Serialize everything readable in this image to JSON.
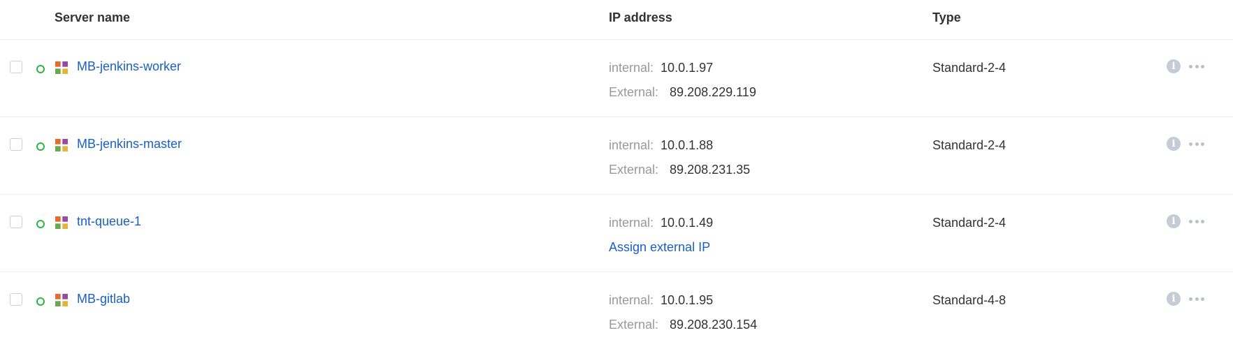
{
  "columns": {
    "server_name": "Server name",
    "ip_address": "IP address",
    "type": "Type"
  },
  "colors": {
    "link": "#1a5fc4",
    "status_active": "#2fb344",
    "muted": "#999999"
  },
  "icons": {
    "os": "os-logo-icon",
    "status": "status-active-icon",
    "info": "info-icon",
    "menu": "more-icon"
  },
  "servers": [
    {
      "name": "MB-jenkins-worker",
      "internal_label": "internal:",
      "internal_ip": "10.0.1.97",
      "external_label": "External:",
      "external_ip": "89.208.229.119",
      "type": "Standard-2-4"
    },
    {
      "name": "MB-jenkins-master",
      "internal_label": "internal:",
      "internal_ip": "10.0.1.88",
      "external_label": "External:",
      "external_ip": "89.208.231.35",
      "type": "Standard-2-4"
    },
    {
      "name": "tnt-queue-1",
      "internal_label": "internal:",
      "internal_ip": "10.0.1.49",
      "assign_external_label": "Assign external IP",
      "type": "Standard-2-4"
    },
    {
      "name": "MB-gitlab",
      "internal_label": "internal:",
      "internal_ip": "10.0.1.95",
      "external_label": "External:",
      "external_ip": "89.208.230.154",
      "type": "Standard-4-8"
    }
  ]
}
